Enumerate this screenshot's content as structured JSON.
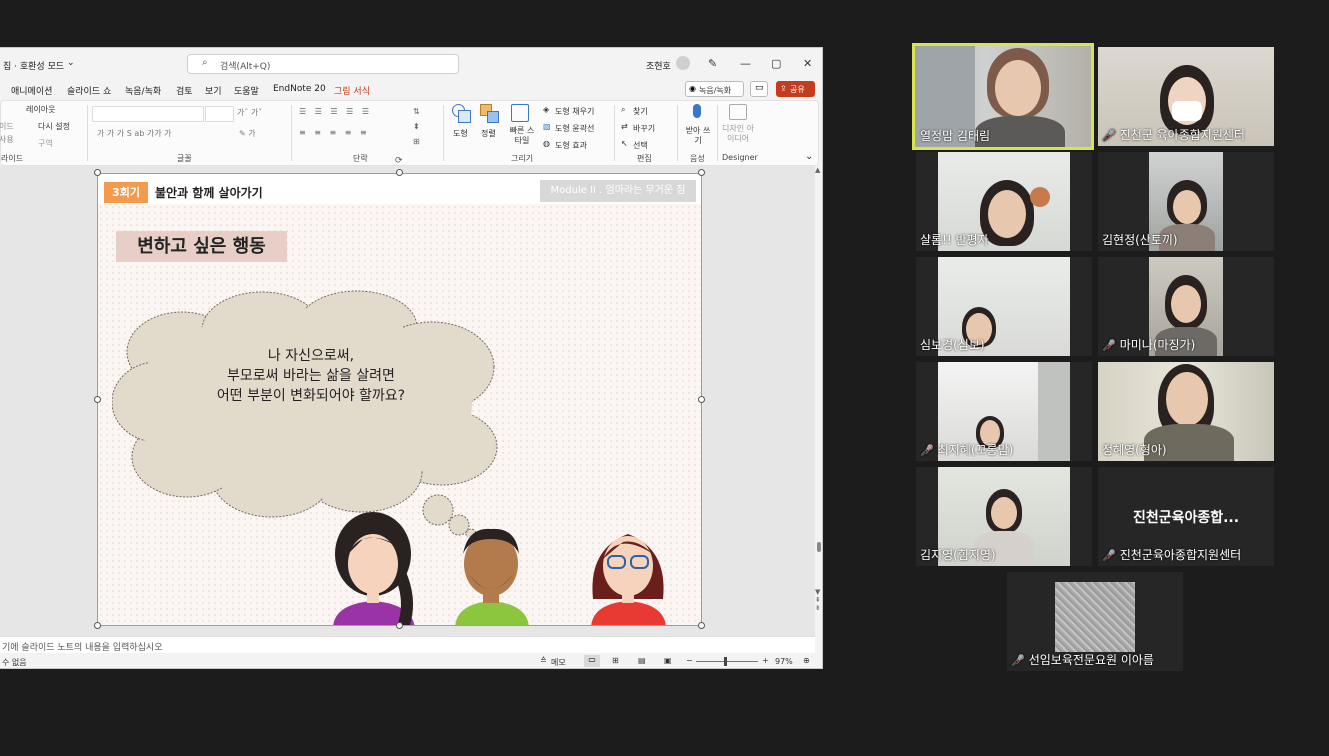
{
  "ppt": {
    "title_left": "집 · 호환성 모드",
    "search_placeholder": "검색(Alt+Q)",
    "user_name": "조현호",
    "menu": [
      "애니메이션",
      "슬라이드 쇼",
      "녹음/녹화",
      "검토",
      "보기",
      "도움말",
      "EndNote 20",
      "그림 서식"
    ],
    "record_button": "녹음/녹화",
    "share_button": "공유",
    "ribbon": {
      "layout": "레이아웃",
      "reset": "다시 설정",
      "section": "구역",
      "slide_group_left": "이드",
      "slide_group_left2": "사용",
      "group_slides": "라이드",
      "group_font": "글꼴",
      "group_paragraph": "단락",
      "group_drawing": "그리기",
      "group_editing": "편집",
      "group_voice": "음성",
      "group_designer": "Designer",
      "shape": "도형",
      "arrange": "정렬",
      "quick_style": "빠른 스타일",
      "fill": "도형 채우기",
      "outline": "도형 윤곽선",
      "effects": "도형 효과",
      "find": "찾기",
      "replace": "바꾸기",
      "select": "선택",
      "dictate": "받아 쓰기",
      "design_ideas": "디자인 아이디어"
    },
    "slide": {
      "badge": "3회기",
      "title": "불안과 함께 살아가기",
      "module": "Module II . 엄마라는 무거운 짐",
      "heading": "변하고 싶은 행동",
      "cloud_line1": "나 자신으로써,",
      "cloud_line2": "부모로써 바라는 삶을 살려면",
      "cloud_line3": "어떤 부분이 변화되어야 할까요?"
    },
    "notes_placeholder": "기에 슬라이드 노트의 내용을 입력하십시오",
    "status_left": "수 없음",
    "status_notes": "메모",
    "zoom_level": "97%"
  },
  "participants": [
    {
      "name": "열정맘 김태림",
      "muted": false,
      "active": true
    },
    {
      "name": "진천군 육아종합지원센터",
      "muted": true
    },
    {
      "name": "샬롬!! 반평자",
      "muted": false
    },
    {
      "name": "김현정(산토끼)",
      "muted": false
    },
    {
      "name": "심보경(심보)",
      "muted": false
    },
    {
      "name": "마미나(마징가)",
      "muted": true
    },
    {
      "name": "최지혜(꼬롱맘)",
      "muted": true
    },
    {
      "name": "정혜영(형아)",
      "muted": false
    },
    {
      "name": "김지영(힘지영)",
      "muted": false
    },
    {
      "name": "진천군육아종합지원센터",
      "muted": true,
      "display_text": "진천군육아종합..."
    },
    {
      "name": "선임보육전문요원 이아름",
      "muted": true
    }
  ],
  "colors": {
    "active_border": "#d7e34f",
    "badge": "#f39a4b",
    "heading_bg": "#e7cfc7",
    "cloud": "#e2dacb",
    "mute": "#e34444"
  }
}
